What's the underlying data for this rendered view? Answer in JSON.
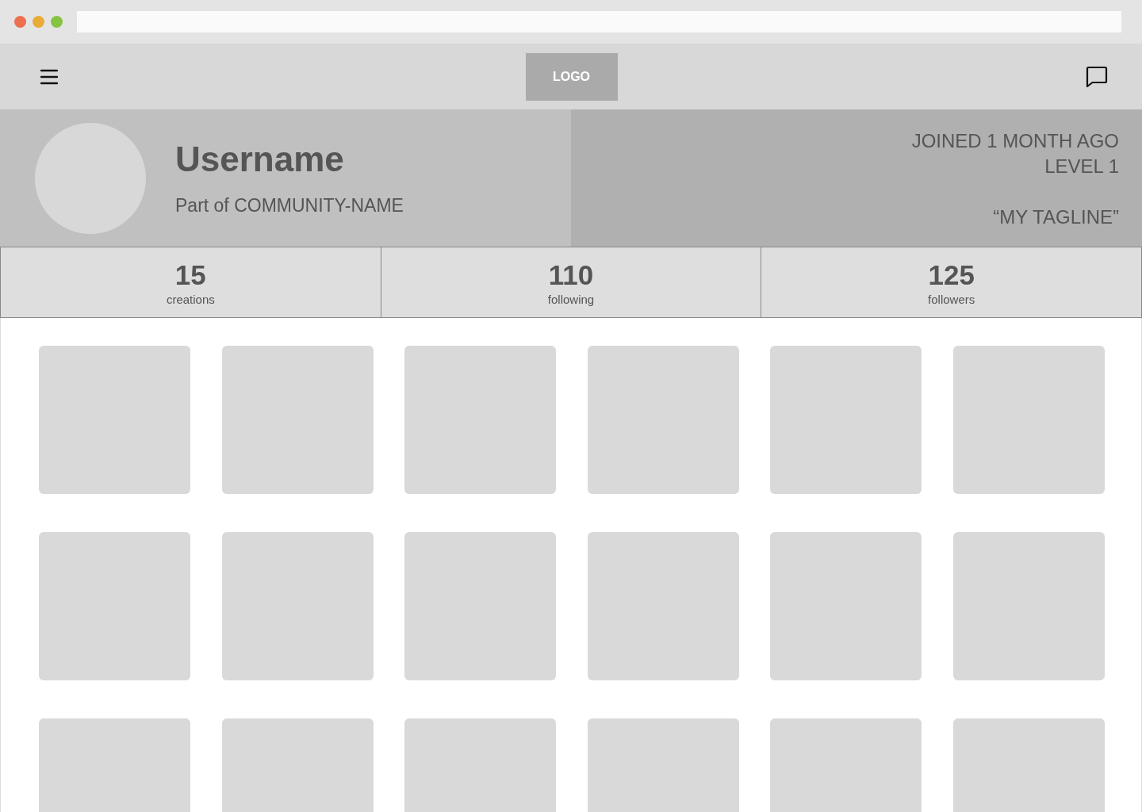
{
  "browser": {
    "controls": [
      {
        "color": "#ec6f4f"
      },
      {
        "color": "#e9ab37"
      },
      {
        "color": "#85c440"
      }
    ],
    "address_bar": {
      "kind": "empty"
    }
  },
  "header": {
    "logo": "LOGO"
  },
  "profile": {
    "username": "Username",
    "community": "Part of COMMUNITY-NAME",
    "joined": "JOINED 1 MONTH AGO",
    "level": "LEVEL 1",
    "tagline": "“MY TAGLINE”"
  },
  "stats": [
    {
      "value": "15",
      "label": "creations"
    },
    {
      "value": "110",
      "label": "following"
    },
    {
      "value": "125",
      "label": "followers"
    }
  ],
  "creations": [
    {
      "kind": "placeholder"
    },
    {
      "kind": "placeholder"
    },
    {
      "kind": "placeholder"
    },
    {
      "kind": "placeholder"
    },
    {
      "kind": "placeholder"
    },
    {
      "kind": "placeholder"
    },
    {
      "kind": "placeholder"
    },
    {
      "kind": "placeholder"
    },
    {
      "kind": "placeholder"
    },
    {
      "kind": "placeholder"
    },
    {
      "kind": "placeholder"
    },
    {
      "kind": "placeholder"
    },
    {
      "kind": "placeholder"
    },
    {
      "kind": "placeholder"
    },
    {
      "kind": "placeholder"
    },
    {
      "kind": "placeholder"
    },
    {
      "kind": "placeholder"
    },
    {
      "kind": "placeholder"
    }
  ]
}
